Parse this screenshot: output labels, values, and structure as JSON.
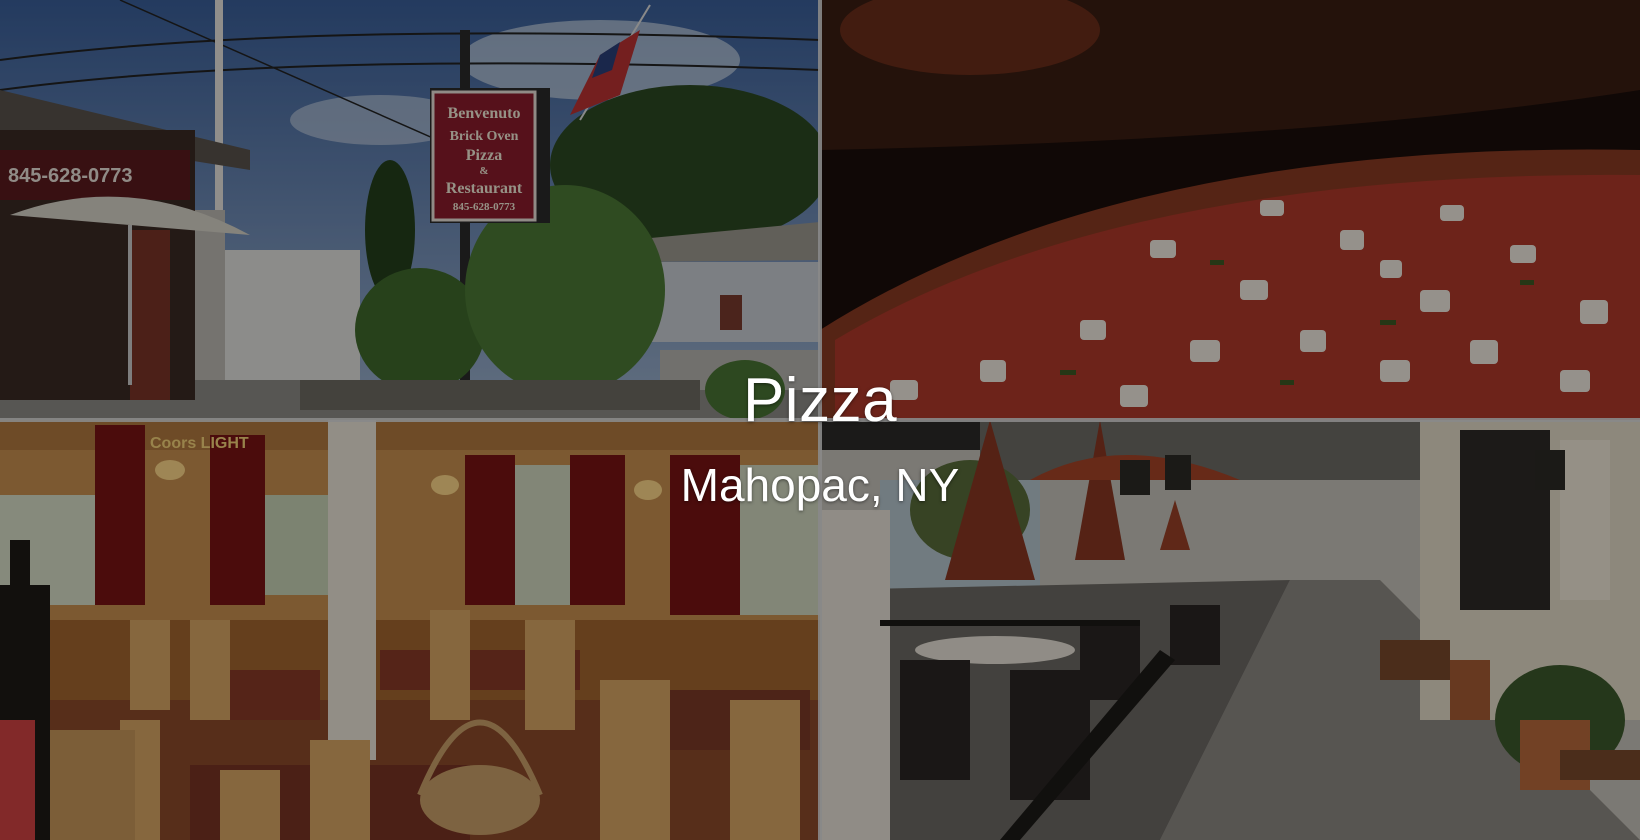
{
  "hero": {
    "title": "Pizza",
    "subtitle": "Mahopac, NY"
  },
  "photos": {
    "storefront": {
      "sign_lines": [
        "Benvenuto",
        "Brick Oven",
        "Pizza",
        "&",
        "Restaurant",
        "845-628-0773"
      ],
      "awning_phone": "845-628-0773"
    },
    "dining_room": {
      "neon_sign": "Coors LIGHT"
    }
  },
  "colors": {
    "overlay": "rgba(0,0,0,0.38)",
    "title_text": "#ffffff",
    "sign_red": "#8c1c2c",
    "wall_warm": "#c9904f"
  }
}
